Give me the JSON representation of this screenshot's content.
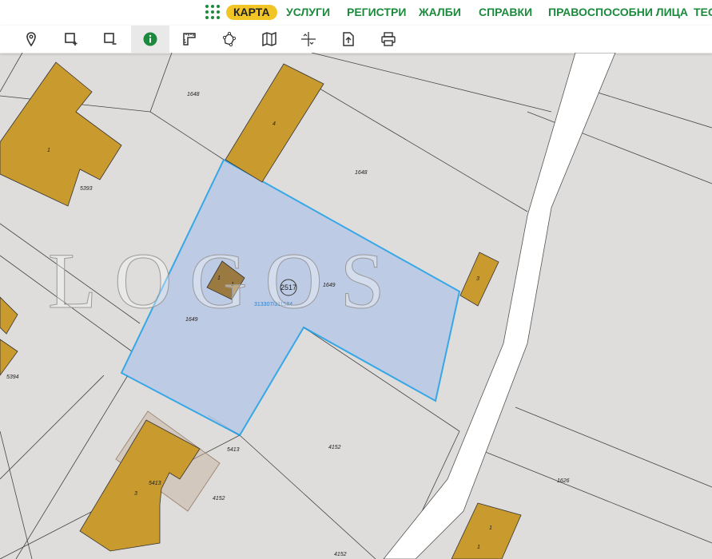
{
  "nav": {
    "items": [
      {
        "label": "КАРТА",
        "active": true
      },
      {
        "label": "УСЛУГИ"
      },
      {
        "label": "РЕГИСТРИ"
      },
      {
        "label": "ЖАЛБИ"
      },
      {
        "label": "СПРАВКИ"
      },
      {
        "label": "ПРАВОСПОСОБНИ ЛИЦА"
      },
      {
        "label": "ТЕС"
      }
    ],
    "accent_color": "#1b8a3c",
    "active_color": "#f2c526"
  },
  "toolbar": {
    "tools": [
      "marker-icon",
      "add-selection-icon",
      "remove-selection-icon",
      "info-icon",
      "measure-icon",
      "polygon-icon",
      "map-layers-icon",
      "coordinates-icon",
      "export-icon",
      "print-icon"
    ],
    "active_tool": "info-icon"
  },
  "map": {
    "watermark": "LOGOS",
    "selected_parcel": {
      "number": "1649",
      "fill": "#b8c9e6",
      "stroke": "#1a9ee8"
    },
    "parcel_labels": {
      "p1648_top": "1648",
      "p1648_mid": "1648",
      "p1649": "1649",
      "p1649_b": "1649",
      "p5393": "5393",
      "p5394": "5394",
      "p5413_a": "5413",
      "p5413_b": "5413",
      "p4152_a": "4152",
      "p4152_b": "4152",
      "p4152_c": "4152",
      "p1626": "1626"
    },
    "building_labels": {
      "b_big": "1",
      "b_top": "4",
      "b_small": "1",
      "b_small_b": "1",
      "b_right": "3",
      "b_bottom_left": "3",
      "b_bottom_right_a": "1",
      "b_bottom_right_b": "1"
    },
    "marker": {
      "label": "2517",
      "coords": "313307/311584"
    },
    "building_color": "#c99a2e"
  }
}
